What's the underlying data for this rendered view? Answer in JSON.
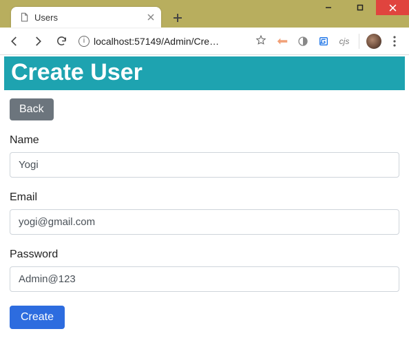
{
  "window": {
    "tab_title": "Users",
    "url_display": "localhost:57149/Admin/Cre…",
    "extensions": {
      "cjs_label": "cjs"
    }
  },
  "page": {
    "heading": "Create User",
    "back_label": "Back",
    "form": {
      "name_label": "Name",
      "name_value": "Yogi",
      "email_label": "Email",
      "email_value": "yogi@gmail.com",
      "password_label": "Password",
      "password_value": "Admin@123"
    },
    "submit_label": "Create"
  },
  "colors": {
    "banner": "#1ea3b0",
    "primary_button": "#2d6cdf",
    "secondary_button": "#6c757d"
  }
}
